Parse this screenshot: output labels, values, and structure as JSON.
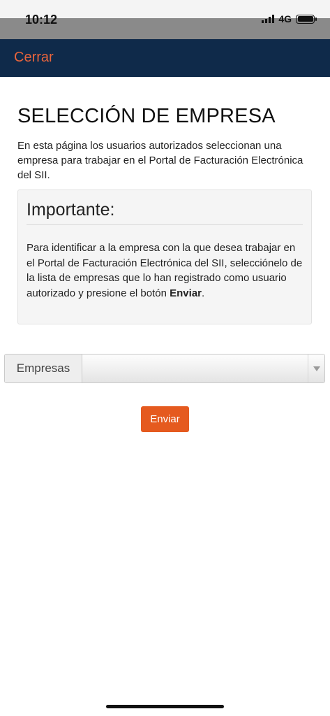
{
  "status_bar": {
    "time": "10:12",
    "network": "4G",
    "signal_icon": "signal-icon",
    "battery_icon": "battery-icon"
  },
  "navbar": {
    "close_label": "Cerrar",
    "bg_color": "#0f2a4a",
    "link_color": "#e8643c"
  },
  "page": {
    "title": "SELECCIÓN DE EMPRESA",
    "intro": "En esta página los usuarios autorizados seleccionan una empresa para trabajar en el Portal de Facturación Electrónica del SII."
  },
  "notice": {
    "title": "Importante:",
    "body_text": "Para identificar a la empresa con la que desea trabajar en el Portal de Facturación Electrónica del SII, selecciónelo de la lista de empresas que lo han registrado como usuario autorizado y presione el botón ",
    "body_bold": "Enviar",
    "body_end": "."
  },
  "form": {
    "select_label": "Empresas",
    "select_value": "",
    "select_icon": "chevron-down-icon",
    "submit_label": "Enviar",
    "submit_color": "#e55a1f"
  }
}
